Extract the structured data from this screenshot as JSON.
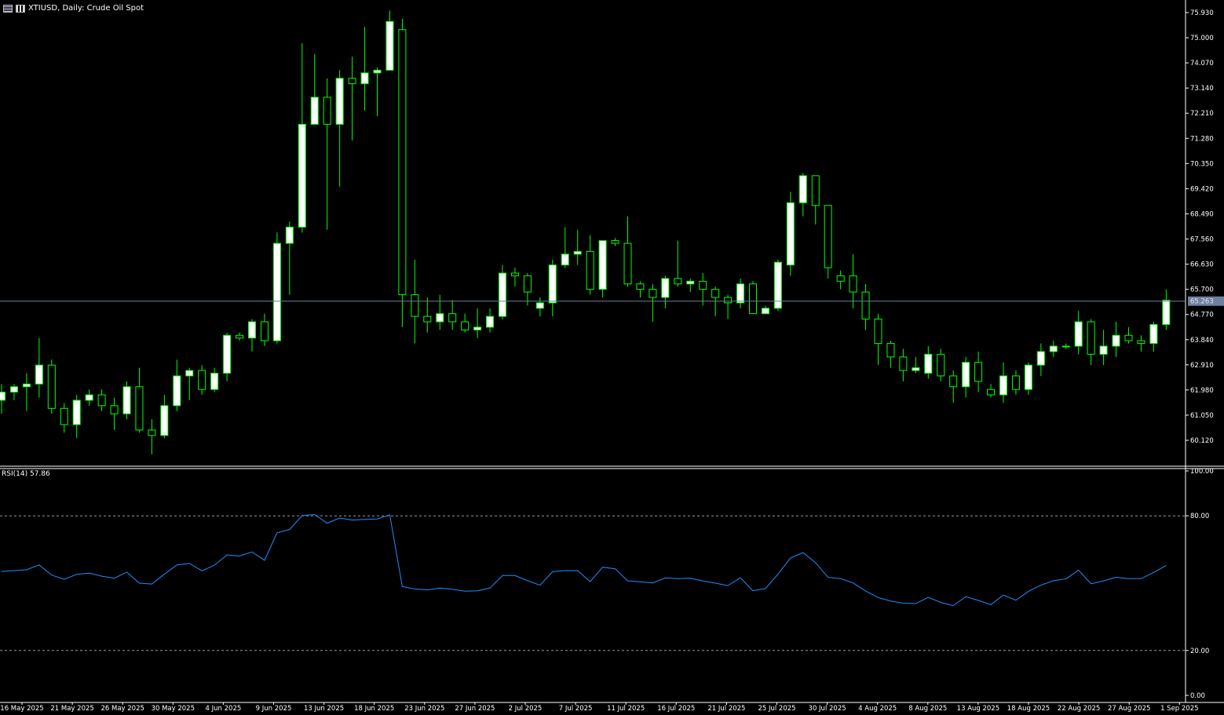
{
  "header": {
    "symbol_title": "XTIUSD, Daily:  Crude Oil Spot",
    "grid_icon": "chart-grid-icon",
    "bars_icon": "chart-bars-icon"
  },
  "rsi_panel": {
    "label": "RSI(14)",
    "value": "57.86",
    "levels": [
      "100.00",
      "80.00",
      "20.00",
      "0.00"
    ]
  },
  "price_marker": "65.263",
  "colors": {
    "background": "#000000",
    "up_candle": "#ffffff",
    "down_candle": "#000000",
    "wick": "#00ff00",
    "rsi_line": "#1e90ff",
    "axis": "#ffffff",
    "price_line": "#6f7f9f"
  },
  "chart_data": [
    {
      "type": "candlestick",
      "title": "XTIUSD, Daily:  Crude Oil Spot",
      "y_ticks": [
        "75.930",
        "75.000",
        "74.070",
        "73.140",
        "72.210",
        "71.280",
        "70.350",
        "69.420",
        "68.490",
        "67.560",
        "66.630",
        "65.700",
        "64.770",
        "63.840",
        "62.910",
        "61.980",
        "61.050",
        "60.120"
      ],
      "ylim": [
        59.3,
        76.4
      ],
      "x_ticks": [
        "16 May 2025",
        "21 May 2025",
        "26 May 2025",
        "30 May 2025",
        "4 Jun 2025",
        "9 Jun 2025",
        "13 Jun 2025",
        "18 Jun 2025",
        "23 Jun 2025",
        "27 Jun 2025",
        "2 Jul 2025",
        "7 Jul 2025",
        "11 Jul 2025",
        "16 Jul 2025",
        "21 Jul 2025",
        "25 Jul 2025",
        "30 Jul 2025",
        "4 Aug 2025",
        "8 Aug 2025",
        "13 Aug 2025",
        "18 Aug 2025",
        "22 Aug 2025",
        "27 Aug 2025",
        "1 Sep 2025"
      ],
      "current_price": 65.263,
      "candles": [
        {
          "o": 61.6,
          "h": 62.2,
          "l": 61.1,
          "c": 61.9
        },
        {
          "o": 61.9,
          "h": 62.2,
          "l": 61.6,
          "c": 62.1
        },
        {
          "o": 62.1,
          "h": 62.6,
          "l": 61.2,
          "c": 62.2
        },
        {
          "o": 62.2,
          "h": 63.9,
          "l": 61.7,
          "c": 62.9
        },
        {
          "o": 62.9,
          "h": 63.1,
          "l": 61.1,
          "c": 61.3
        },
        {
          "o": 61.3,
          "h": 61.5,
          "l": 60.4,
          "c": 60.7
        },
        {
          "o": 60.7,
          "h": 61.8,
          "l": 60.2,
          "c": 61.6
        },
        {
          "o": 61.6,
          "h": 62.0,
          "l": 61.4,
          "c": 61.8
        },
        {
          "o": 61.8,
          "h": 62.0,
          "l": 61.2,
          "c": 61.4
        },
        {
          "o": 61.4,
          "h": 61.7,
          "l": 60.5,
          "c": 61.1
        },
        {
          "o": 61.1,
          "h": 62.3,
          "l": 60.9,
          "c": 62.1
        },
        {
          "o": 62.1,
          "h": 62.8,
          "l": 60.4,
          "c": 60.5
        },
        {
          "o": 60.5,
          "h": 60.9,
          "l": 59.6,
          "c": 60.3
        },
        {
          "o": 60.3,
          "h": 61.8,
          "l": 60.2,
          "c": 61.4
        },
        {
          "o": 61.4,
          "h": 63.1,
          "l": 61.2,
          "c": 62.5
        },
        {
          "o": 62.5,
          "h": 62.8,
          "l": 61.6,
          "c": 62.7
        },
        {
          "o": 62.7,
          "h": 62.9,
          "l": 61.8,
          "c": 62.0
        },
        {
          "o": 62.0,
          "h": 62.8,
          "l": 61.9,
          "c": 62.6
        },
        {
          "o": 62.6,
          "h": 64.1,
          "l": 62.3,
          "c": 64.0
        },
        {
          "o": 64.0,
          "h": 64.1,
          "l": 63.8,
          "c": 63.9
        },
        {
          "o": 63.9,
          "h": 64.6,
          "l": 63.4,
          "c": 64.5
        },
        {
          "o": 64.5,
          "h": 64.8,
          "l": 63.6,
          "c": 63.8
        },
        {
          "o": 63.8,
          "h": 67.8,
          "l": 63.7,
          "c": 67.4
        },
        {
          "o": 67.4,
          "h": 68.2,
          "l": 65.5,
          "c": 68.0
        },
        {
          "o": 68.0,
          "h": 74.8,
          "l": 67.8,
          "c": 71.8
        },
        {
          "o": 71.8,
          "h": 74.4,
          "l": 72.6,
          "c": 72.8
        },
        {
          "o": 72.8,
          "h": 73.5,
          "l": 67.9,
          "c": 71.8
        },
        {
          "o": 71.8,
          "h": 73.8,
          "l": 69.5,
          "c": 73.5
        },
        {
          "o": 73.5,
          "h": 74.3,
          "l": 71.2,
          "c": 73.3
        },
        {
          "o": 73.3,
          "h": 75.4,
          "l": 72.3,
          "c": 73.7
        },
        {
          "o": 73.7,
          "h": 73.9,
          "l": 72.1,
          "c": 73.8
        },
        {
          "o": 73.8,
          "h": 76.0,
          "l": 75.0,
          "c": 75.6
        },
        {
          "o": 75.3,
          "h": 75.7,
          "l": 64.3,
          "c": 65.5
        },
        {
          "o": 65.5,
          "h": 66.8,
          "l": 63.7,
          "c": 64.7
        },
        {
          "o": 64.7,
          "h": 65.4,
          "l": 64.1,
          "c": 64.5
        },
        {
          "o": 64.5,
          "h": 65.5,
          "l": 64.2,
          "c": 64.8
        },
        {
          "o": 64.8,
          "h": 65.3,
          "l": 64.2,
          "c": 64.5
        },
        {
          "o": 64.5,
          "h": 64.8,
          "l": 64.1,
          "c": 64.2
        },
        {
          "o": 64.2,
          "h": 65.0,
          "l": 63.9,
          "c": 64.3
        },
        {
          "o": 64.3,
          "h": 65.0,
          "l": 64.1,
          "c": 64.7
        },
        {
          "o": 64.7,
          "h": 66.6,
          "l": 64.6,
          "c": 66.3
        },
        {
          "o": 66.3,
          "h": 66.5,
          "l": 65.8,
          "c": 66.2
        },
        {
          "o": 66.2,
          "h": 66.3,
          "l": 65.1,
          "c": 65.6
        },
        {
          "o": 65.0,
          "h": 65.4,
          "l": 64.7,
          "c": 65.2
        },
        {
          "o": 65.2,
          "h": 66.8,
          "l": 64.7,
          "c": 66.6
        },
        {
          "o": 66.6,
          "h": 68.0,
          "l": 66.5,
          "c": 67.0
        },
        {
          "o": 67.0,
          "h": 67.9,
          "l": 66.6,
          "c": 67.1
        },
        {
          "o": 67.1,
          "h": 67.7,
          "l": 65.5,
          "c": 65.7
        },
        {
          "o": 65.7,
          "h": 67.5,
          "l": 65.4,
          "c": 67.5
        },
        {
          "o": 67.5,
          "h": 67.6,
          "l": 67.3,
          "c": 67.4
        },
        {
          "o": 67.4,
          "h": 68.4,
          "l": 65.8,
          "c": 65.9
        },
        {
          "o": 65.9,
          "h": 66.0,
          "l": 65.4,
          "c": 65.7
        },
        {
          "o": 65.7,
          "h": 65.9,
          "l": 64.5,
          "c": 65.4
        },
        {
          "o": 65.4,
          "h": 66.2,
          "l": 65.0,
          "c": 66.1
        },
        {
          "o": 66.1,
          "h": 67.5,
          "l": 65.8,
          "c": 65.9
        },
        {
          "o": 65.9,
          "h": 66.1,
          "l": 65.6,
          "c": 66.0
        },
        {
          "o": 66.0,
          "h": 66.3,
          "l": 65.1,
          "c": 65.7
        },
        {
          "o": 65.7,
          "h": 65.8,
          "l": 64.7,
          "c": 65.4
        },
        {
          "o": 65.4,
          "h": 65.5,
          "l": 64.6,
          "c": 65.2
        },
        {
          "o": 65.2,
          "h": 66.1,
          "l": 65.0,
          "c": 65.9
        },
        {
          "o": 65.9,
          "h": 66.0,
          "l": 64.8,
          "c": 64.8
        },
        {
          "o": 64.8,
          "h": 65.1,
          "l": 64.8,
          "c": 65.0
        },
        {
          "o": 65.0,
          "h": 66.8,
          "l": 64.9,
          "c": 66.7
        },
        {
          "o": 66.6,
          "h": 69.3,
          "l": 66.2,
          "c": 68.9
        },
        {
          "o": 68.9,
          "h": 70.0,
          "l": 68.4,
          "c": 69.9
        },
        {
          "o": 69.9,
          "h": 69.9,
          "l": 68.1,
          "c": 68.8
        },
        {
          "o": 68.8,
          "h": 68.8,
          "l": 66.1,
          "c": 66.5
        },
        {
          "o": 66.2,
          "h": 66.4,
          "l": 65.7,
          "c": 66.0
        },
        {
          "o": 66.2,
          "h": 67.0,
          "l": 65.0,
          "c": 65.6
        },
        {
          "o": 65.6,
          "h": 65.9,
          "l": 64.2,
          "c": 64.6
        },
        {
          "o": 64.6,
          "h": 64.8,
          "l": 62.9,
          "c": 63.7
        },
        {
          "o": 63.7,
          "h": 63.8,
          "l": 62.8,
          "c": 63.2
        },
        {
          "o": 63.2,
          "h": 63.5,
          "l": 62.3,
          "c": 62.7
        },
        {
          "o": 62.7,
          "h": 63.2,
          "l": 62.6,
          "c": 62.8
        },
        {
          "o": 62.6,
          "h": 63.6,
          "l": 62.4,
          "c": 63.3
        },
        {
          "o": 63.3,
          "h": 63.5,
          "l": 62.3,
          "c": 62.5
        },
        {
          "o": 62.5,
          "h": 62.7,
          "l": 61.5,
          "c": 62.1
        },
        {
          "o": 62.1,
          "h": 63.2,
          "l": 61.7,
          "c": 63.0
        },
        {
          "o": 63.0,
          "h": 63.4,
          "l": 61.9,
          "c": 62.3
        },
        {
          "o": 62.0,
          "h": 62.2,
          "l": 61.7,
          "c": 61.8
        },
        {
          "o": 61.8,
          "h": 63.0,
          "l": 61.5,
          "c": 62.5
        },
        {
          "o": 62.5,
          "h": 62.7,
          "l": 61.8,
          "c": 62.0
        },
        {
          "o": 62.0,
          "h": 63.0,
          "l": 61.8,
          "c": 62.9
        },
        {
          "o": 62.9,
          "h": 63.7,
          "l": 62.5,
          "c": 63.4
        },
        {
          "o": 63.4,
          "h": 63.8,
          "l": 63.2,
          "c": 63.6
        },
        {
          "o": 63.6,
          "h": 63.7,
          "l": 63.5,
          "c": 63.6
        },
        {
          "o": 63.6,
          "h": 64.9,
          "l": 63.3,
          "c": 64.5
        },
        {
          "o": 64.5,
          "h": 64.6,
          "l": 62.9,
          "c": 63.3
        },
        {
          "o": 63.3,
          "h": 64.2,
          "l": 62.9,
          "c": 63.6
        },
        {
          "o": 63.6,
          "h": 64.5,
          "l": 63.2,
          "c": 64.0
        },
        {
          "o": 64.0,
          "h": 64.3,
          "l": 63.7,
          "c": 63.8
        },
        {
          "o": 63.8,
          "h": 64.0,
          "l": 63.4,
          "c": 63.7
        },
        {
          "o": 63.7,
          "h": 64.5,
          "l": 63.4,
          "c": 64.4
        },
        {
          "o": 64.4,
          "h": 65.7,
          "l": 64.2,
          "c": 65.3
        }
      ]
    },
    {
      "type": "line",
      "title": "RSI(14) 57.86",
      "y_ticks": [
        "100.00",
        "80.00",
        "20.00",
        "0.00"
      ],
      "ylim": [
        0,
        100
      ],
      "levels": [
        80,
        20
      ],
      "series": [
        {
          "name": "RSI(14)",
          "values": [
            55.2,
            55.6,
            56.0,
            58.1,
            53.6,
            51.7,
            53.9,
            54.5,
            53.1,
            52.2,
            54.9,
            50.0,
            49.6,
            54.0,
            58.1,
            58.8,
            55.5,
            58.0,
            62.6,
            62.1,
            63.9,
            60.2,
            72.4,
            73.9,
            80.1,
            80.6,
            76.7,
            79.0,
            78.1,
            78.4,
            78.6,
            80.4,
            48.5,
            47.4,
            47.0,
            47.8,
            47.3,
            46.4,
            46.6,
            47.8,
            53.4,
            53.4,
            51.1,
            49.1,
            55.1,
            55.6,
            55.6,
            50.7,
            57.1,
            56.4,
            51.0,
            50.6,
            50.1,
            52.3,
            52.0,
            52.2,
            51.0,
            50.0,
            48.9,
            52.4,
            46.6,
            47.6,
            54.0,
            61.2,
            63.6,
            59.1,
            52.6,
            52.0,
            50.1,
            46.5,
            43.6,
            42.0,
            41.1,
            40.9,
            43.7,
            41.4,
            40.0,
            44.0,
            42.3,
            40.4,
            44.7,
            42.4,
            46.3,
            49.1,
            51.1,
            51.9,
            55.8,
            49.7,
            51.0,
            52.6,
            52.0,
            52.0,
            54.8,
            57.86
          ]
        }
      ]
    }
  ]
}
